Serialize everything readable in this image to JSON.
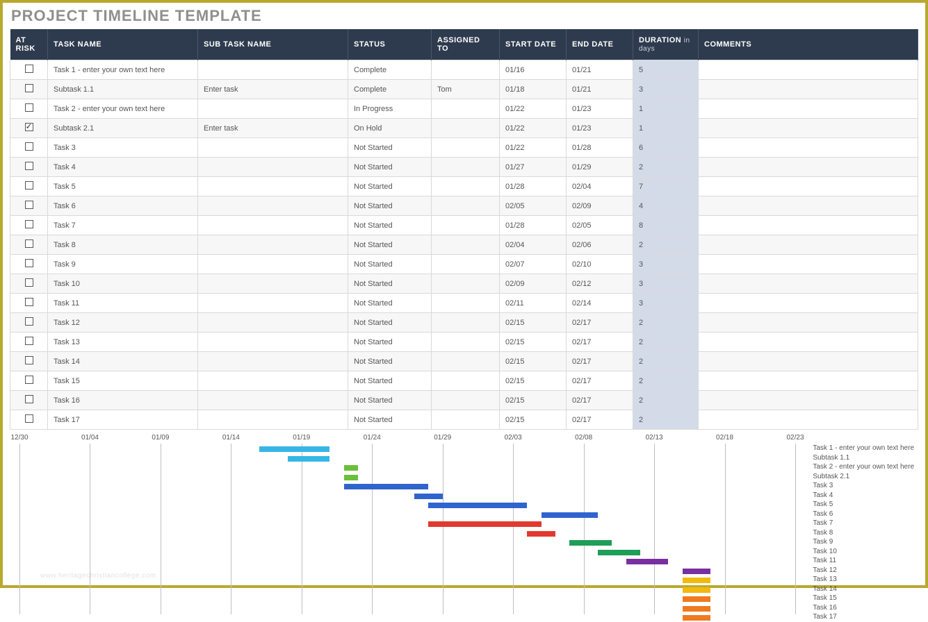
{
  "title": "PROJECT TIMELINE TEMPLATE",
  "headers": {
    "risk": "AT RISK",
    "name": "TASK NAME",
    "sub": "SUB TASK NAME",
    "status": "STATUS",
    "assigned": "ASSIGNED TO",
    "start": "START DATE",
    "end": "END DATE",
    "duration": "DURATION",
    "duration_unit": "in days",
    "comments": "COMMENTS"
  },
  "rows": [
    {
      "risk": false,
      "name": "Task 1 - enter your own text here",
      "sub": "",
      "status": "Complete",
      "assigned": "",
      "start": "01/16",
      "end": "01/21",
      "dur": "5",
      "comments": ""
    },
    {
      "risk": false,
      "name": "Subtask 1.1",
      "sub": "Enter task",
      "status": "Complete",
      "assigned": "Tom",
      "start": "01/18",
      "end": "01/21",
      "dur": "3",
      "comments": ""
    },
    {
      "risk": false,
      "name": "Task 2 - enter your own text here",
      "sub": "",
      "status": "In Progress",
      "assigned": "",
      "start": "01/22",
      "end": "01/23",
      "dur": "1",
      "comments": ""
    },
    {
      "risk": true,
      "name": "Subtask 2.1",
      "sub": "Enter task",
      "status": "On Hold",
      "assigned": "",
      "start": "01/22",
      "end": "01/23",
      "dur": "1",
      "comments": ""
    },
    {
      "risk": false,
      "name": "Task 3",
      "sub": "",
      "status": "Not Started",
      "assigned": "",
      "start": "01/22",
      "end": "01/28",
      "dur": "6",
      "comments": ""
    },
    {
      "risk": false,
      "name": "Task 4",
      "sub": "",
      "status": "Not Started",
      "assigned": "",
      "start": "01/27",
      "end": "01/29",
      "dur": "2",
      "comments": ""
    },
    {
      "risk": false,
      "name": "Task 5",
      "sub": "",
      "status": "Not Started",
      "assigned": "",
      "start": "01/28",
      "end": "02/04",
      "dur": "7",
      "comments": ""
    },
    {
      "risk": false,
      "name": "Task 6",
      "sub": "",
      "status": "Not Started",
      "assigned": "",
      "start": "02/05",
      "end": "02/09",
      "dur": "4",
      "comments": ""
    },
    {
      "risk": false,
      "name": "Task 7",
      "sub": "",
      "status": "Not Started",
      "assigned": "",
      "start": "01/28",
      "end": "02/05",
      "dur": "8",
      "comments": ""
    },
    {
      "risk": false,
      "name": "Task 8",
      "sub": "",
      "status": "Not Started",
      "assigned": "",
      "start": "02/04",
      "end": "02/06",
      "dur": "2",
      "comments": ""
    },
    {
      "risk": false,
      "name": "Task 9",
      "sub": "",
      "status": "Not Started",
      "assigned": "",
      "start": "02/07",
      "end": "02/10",
      "dur": "3",
      "comments": ""
    },
    {
      "risk": false,
      "name": "Task 10",
      "sub": "",
      "status": "Not Started",
      "assigned": "",
      "start": "02/09",
      "end": "02/12",
      "dur": "3",
      "comments": ""
    },
    {
      "risk": false,
      "name": "Task 11",
      "sub": "",
      "status": "Not Started",
      "assigned": "",
      "start": "02/11",
      "end": "02/14",
      "dur": "3",
      "comments": ""
    },
    {
      "risk": false,
      "name": "Task 12",
      "sub": "",
      "status": "Not Started",
      "assigned": "",
      "start": "02/15",
      "end": "02/17",
      "dur": "2",
      "comments": ""
    },
    {
      "risk": false,
      "name": "Task 13",
      "sub": "",
      "status": "Not Started",
      "assigned": "",
      "start": "02/15",
      "end": "02/17",
      "dur": "2",
      "comments": ""
    },
    {
      "risk": false,
      "name": "Task 14",
      "sub": "",
      "status": "Not Started",
      "assigned": "",
      "start": "02/15",
      "end": "02/17",
      "dur": "2",
      "comments": ""
    },
    {
      "risk": false,
      "name": "Task 15",
      "sub": "",
      "status": "Not Started",
      "assigned": "",
      "start": "02/15",
      "end": "02/17",
      "dur": "2",
      "comments": ""
    },
    {
      "risk": false,
      "name": "Task 16",
      "sub": "",
      "status": "Not Started",
      "assigned": "",
      "start": "02/15",
      "end": "02/17",
      "dur": "2",
      "comments": ""
    },
    {
      "risk": false,
      "name": "Task 17",
      "sub": "",
      "status": "Not Started",
      "assigned": "",
      "start": "02/15",
      "end": "02/17",
      "dur": "2",
      "comments": ""
    }
  ],
  "chart_data": {
    "type": "gantt",
    "x_ticks": [
      "12/30",
      "01/04",
      "01/09",
      "01/14",
      "01/19",
      "01/24",
      "01/29",
      "02/03",
      "02/08",
      "02/13",
      "02/18",
      "02/23"
    ],
    "x_range_days": {
      "start": "12/30",
      "end": "02/23"
    },
    "bars": [
      {
        "label": "Task 1 - enter your own text here",
        "start": "01/16",
        "end": "01/21",
        "color": "#36b6e6"
      },
      {
        "label": "Subtask 1.1",
        "start": "01/18",
        "end": "01/21",
        "color": "#36b6e6"
      },
      {
        "label": "Task 2 - enter your own text here",
        "start": "01/22",
        "end": "01/23",
        "color": "#6bbf3b"
      },
      {
        "label": "Subtask 2.1",
        "start": "01/22",
        "end": "01/23",
        "color": "#6bbf3b"
      },
      {
        "label": "Task 3",
        "start": "01/22",
        "end": "01/28",
        "color": "#2f64cf"
      },
      {
        "label": "Task 4",
        "start": "01/27",
        "end": "01/29",
        "color": "#2f64cf"
      },
      {
        "label": "Task 5",
        "start": "01/28",
        "end": "02/04",
        "color": "#2f64cf"
      },
      {
        "label": "Task 6",
        "start": "02/05",
        "end": "02/09",
        "color": "#2f64cf"
      },
      {
        "label": "Task 7",
        "start": "01/28",
        "end": "02/05",
        "color": "#e03a2f"
      },
      {
        "label": "Task 8",
        "start": "02/04",
        "end": "02/06",
        "color": "#e03a2f"
      },
      {
        "label": "Task 9",
        "start": "02/07",
        "end": "02/10",
        "color": "#1e9e57"
      },
      {
        "label": "Task 10",
        "start": "02/09",
        "end": "02/12",
        "color": "#1e9e57"
      },
      {
        "label": "Task 11",
        "start": "02/11",
        "end": "02/14",
        "color": "#7a2fa0"
      },
      {
        "label": "Task 12",
        "start": "02/15",
        "end": "02/17",
        "color": "#7a2fa0"
      },
      {
        "label": "Task 13",
        "start": "02/15",
        "end": "02/17",
        "color": "#f2b90f"
      },
      {
        "label": "Task 14",
        "start": "02/15",
        "end": "02/17",
        "color": "#f2b90f"
      },
      {
        "label": "Task 15",
        "start": "02/15",
        "end": "02/17",
        "color": "#ef7b1f"
      },
      {
        "label": "Task 16",
        "start": "02/15",
        "end": "02/17",
        "color": "#ef7b1f"
      },
      {
        "label": "Task 17",
        "start": "02/15",
        "end": "02/17",
        "color": "#ef7b1f"
      }
    ]
  },
  "watermark": "www.heritagechristiancollege.com"
}
